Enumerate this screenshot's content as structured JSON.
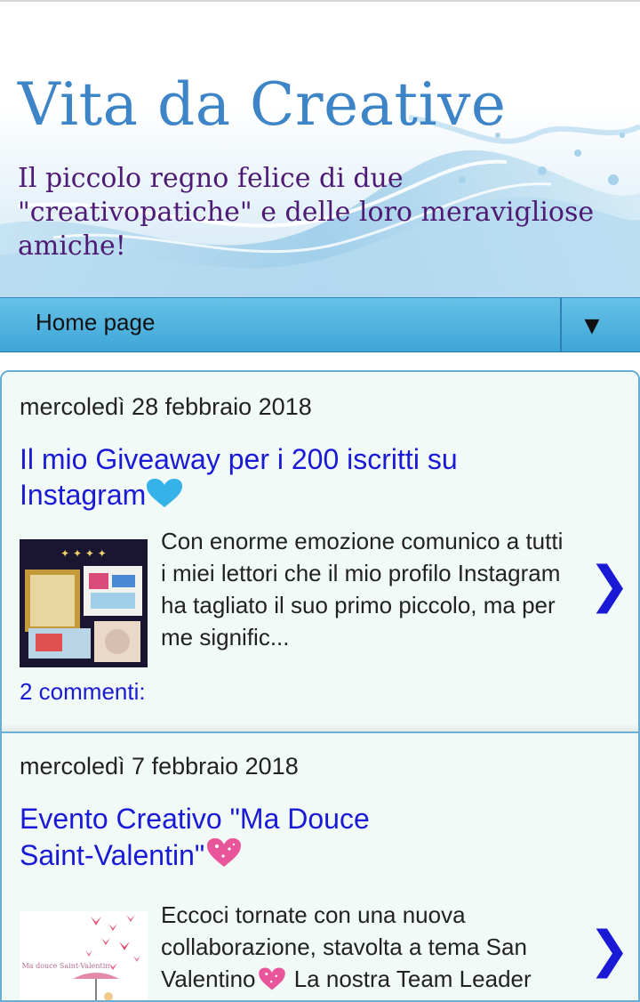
{
  "blog": {
    "title": "Vita da Creative",
    "description": "Il piccolo regno felice di due \"creativopatiche\" e delle loro meravigliose amiche!"
  },
  "nav": {
    "home_label": "Home page",
    "toggle_glyph": "▼"
  },
  "colors": {
    "title": "#3d85c6",
    "description": "#4d1a74",
    "link": "#1a1ad6",
    "nav": "#4db3e0",
    "post_bg": "#f2faf7"
  },
  "posts": [
    {
      "date": "mercoledì 28 febbraio 2018",
      "title": "Il mio Giveaway per i 200 iscritti su Instagram",
      "title_emoji": "blue-heart-icon",
      "snippet": "Con enorme emozione comunico a tutti i miei lettori che il mio profilo Instagram ha tagliato il suo primo piccolo, ma per me signific...",
      "comments": "2 commenti:",
      "arrow": "❯"
    },
    {
      "date": "mercoledì 7 febbraio 2018",
      "title": "Evento Creativo \"Ma Douce Saint-Valentin\"",
      "title_emoji": "sparkling-heart-icon",
      "snippet_pre": "Eccoci tornate con una nuova collaborazione, stavolta a tema San Valentino",
      "snippet_post": " La nostra Team Leader Veronica ha preparato un logo",
      "arrow": "❯"
    }
  ]
}
